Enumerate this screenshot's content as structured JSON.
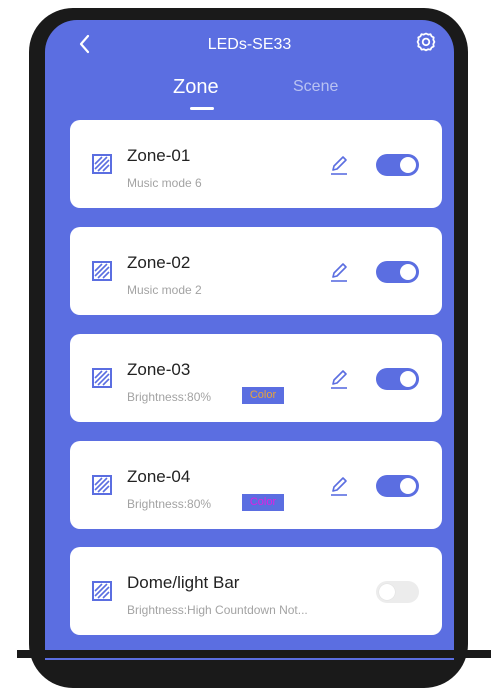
{
  "header": {
    "title": "LEDs-SE33",
    "back_icon": "chevron-left-icon",
    "settings_icon": "gear-icon"
  },
  "tabs": [
    {
      "label": "Zone",
      "active": true
    },
    {
      "label": "Scene",
      "active": false
    }
  ],
  "zones": [
    {
      "name": "Zone-01",
      "status": "Music mode 6",
      "color_label": "",
      "enabled": true
    },
    {
      "name": "Zone-02",
      "status": "Music mode 2",
      "color_label": "",
      "enabled": true
    },
    {
      "name": "Zone-03",
      "status": "Brightness:80%",
      "color_label": "Color",
      "color_text": "#e8a33a",
      "enabled": true
    },
    {
      "name": "Zone-04",
      "status": "Brightness:80%",
      "color_label": "Color",
      "color_text": "#e020e0",
      "enabled": true
    },
    {
      "name": "Dome/light Bar",
      "status": "Brightness:High   Countdown Not...",
      "color_label": "",
      "enabled": false
    }
  ],
  "colors": {
    "accent": "#5b6ee1",
    "card_bg": "#ffffff",
    "toggle_off": "#ececec"
  }
}
